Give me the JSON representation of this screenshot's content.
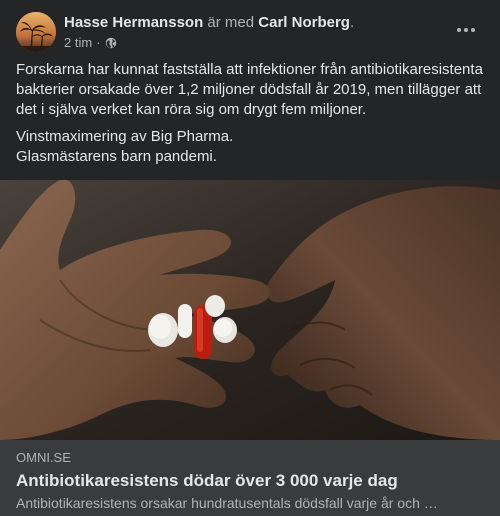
{
  "post": {
    "author": "Hasse Hermansson",
    "with_text": "är med",
    "tagged": "Carl Norberg",
    "period": ".",
    "time": "2 tim",
    "separator": "·",
    "privacy_icon": "globe-icon",
    "more_icon": "more-horizontal-icon",
    "paragraphs": [
      "Forskarna har kunnat fastställa att infektioner från antibiotikaresistenta bakterier orsakade över 1,2 miljoner dödsfall år 2019, men tillägger att det i själva verket kan röra sig om drygt fem miljoner.",
      "Vinstmaximering av Big Pharma.",
      "Glasmästarens barn pandemi."
    ]
  },
  "link": {
    "domain": "OMNI.SE",
    "headline": "Antibiotikaresistens dödar över 3 000 varje dag",
    "description": "Antibiotikaresistens orsakar hundratusentals dödsfall varje år och …"
  },
  "colors": {
    "background": "#242526",
    "card": "#3a3b3c",
    "text_primary": "#e4e6eb",
    "text_secondary": "#b0b3b8"
  }
}
